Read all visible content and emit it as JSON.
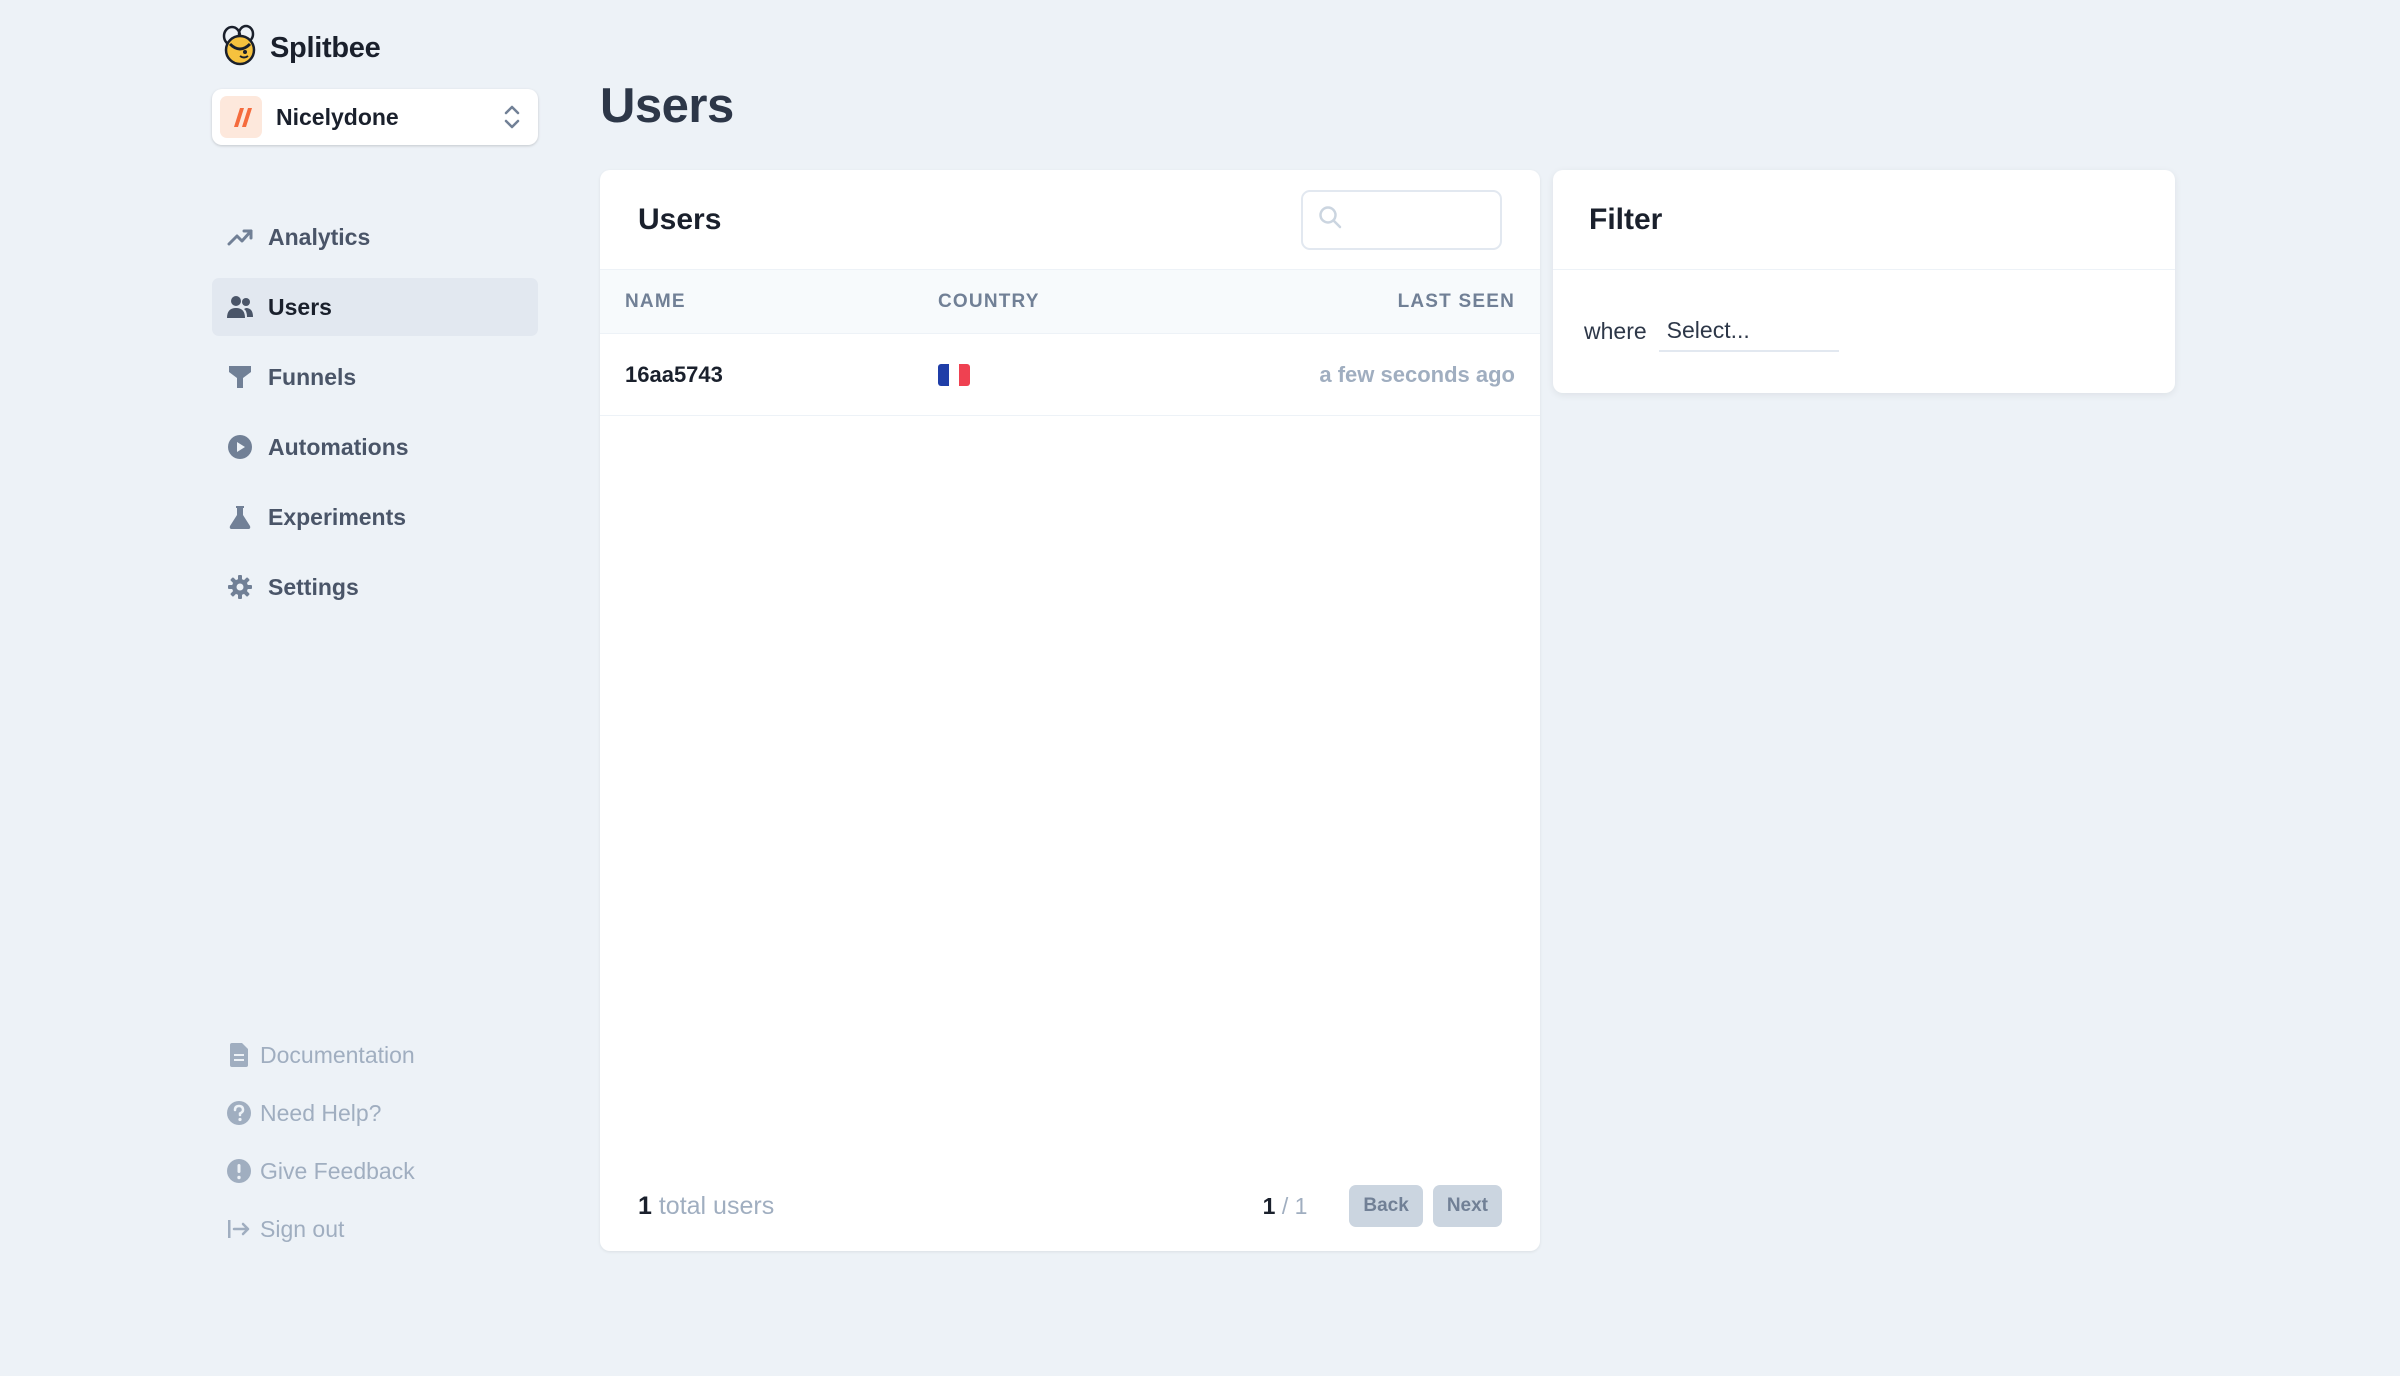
{
  "app": {
    "name": "Splitbee"
  },
  "project": {
    "name": "Nicelydone"
  },
  "nav": [
    {
      "label": "Analytics",
      "icon": "trending-up-icon",
      "active": false
    },
    {
      "label": "Users",
      "icon": "users-icon",
      "active": true
    },
    {
      "label": "Funnels",
      "icon": "funnel-icon",
      "active": false
    },
    {
      "label": "Automations",
      "icon": "play-circle-icon",
      "active": false
    },
    {
      "label": "Experiments",
      "icon": "flask-icon",
      "active": false
    },
    {
      "label": "Settings",
      "icon": "gear-icon",
      "active": false
    }
  ],
  "bottom_nav": [
    {
      "label": "Documentation",
      "icon": "document-icon"
    },
    {
      "label": "Need Help?",
      "icon": "question-circle-icon"
    },
    {
      "label": "Give Feedback",
      "icon": "exclamation-circle-icon"
    },
    {
      "label": "Sign out",
      "icon": "sign-out-icon"
    }
  ],
  "page": {
    "title": "Users"
  },
  "users_card": {
    "title": "Users",
    "search": {
      "value": "",
      "placeholder": ""
    },
    "columns": {
      "name": "NAME",
      "country": "COUNTRY",
      "last_seen": "LAST SEEN"
    },
    "rows": [
      {
        "name": "16aa5743",
        "country_flag": "france-flag",
        "last_seen": "a few seconds ago"
      }
    ],
    "footer": {
      "total_count": "1",
      "total_label": "total users",
      "page_current": "1",
      "page_total": "/ 1",
      "back_label": "Back",
      "next_label": "Next"
    }
  },
  "filter": {
    "title": "Filter",
    "where_label": "where",
    "select_value": "Select..."
  },
  "colors": {
    "background": "#edf2f7",
    "active_nav": "#e2e8f0",
    "muted_text": "#a0aec0",
    "button_bg": "#cbd5e0",
    "brand_accent": "#f56b3d",
    "flag_blue": "#1f3ea8",
    "flag_red": "#ef4151"
  }
}
